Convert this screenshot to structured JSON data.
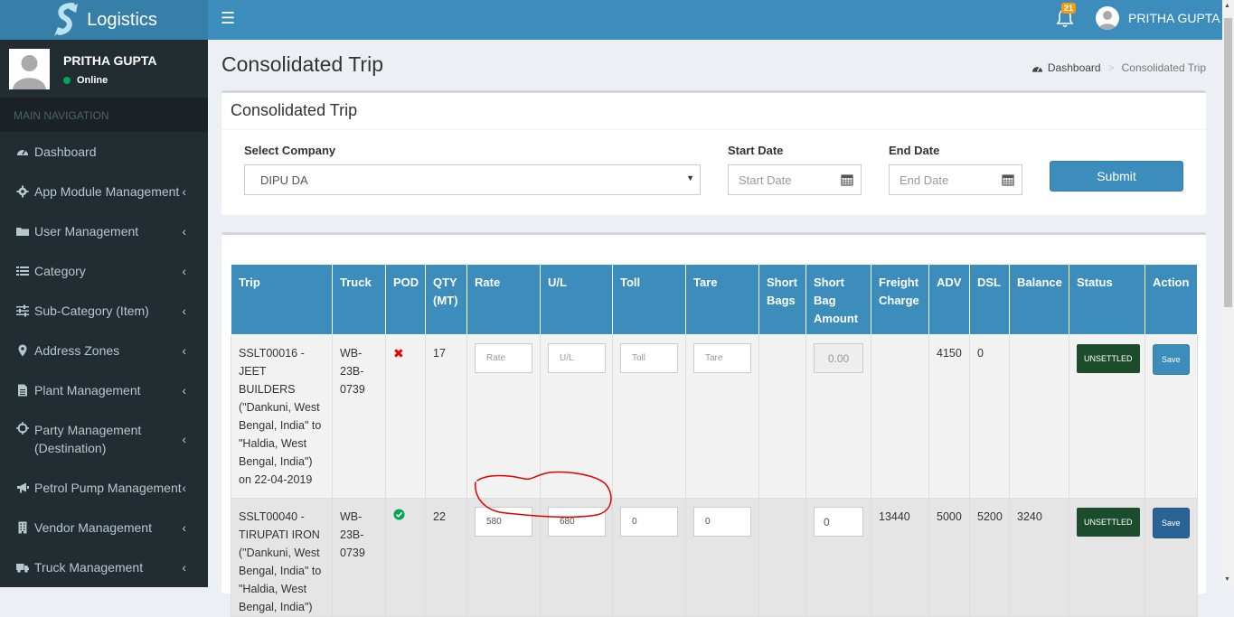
{
  "brand": {
    "name": "Logistics"
  },
  "header": {
    "notification_count": "21",
    "user_name": "PRITHA GUPTA"
  },
  "sidebar": {
    "user": {
      "name": "PRITHA GUPTA",
      "status": "Online"
    },
    "nav_header": "MAIN NAVIGATION",
    "items": [
      {
        "label": "Dashboard",
        "icon": "dashboard-icon"
      },
      {
        "label": "App Module Management",
        "icon": "gear-icon"
      },
      {
        "label": "User Management",
        "icon": "folder-icon"
      },
      {
        "label": "Category",
        "icon": "list-icon"
      },
      {
        "label": "Sub-Category (Item)",
        "icon": "sliders-icon"
      },
      {
        "label": "Address Zones",
        "icon": "map-marker-icon"
      },
      {
        "label": "Plant Management",
        "icon": "file-icon"
      },
      {
        "label": "Party Management (Destination)",
        "icon": "crosshair-icon"
      },
      {
        "label": "Petrol Pump Management",
        "icon": "bullhorn-icon"
      },
      {
        "label": "Vendor Management",
        "icon": "building-icon"
      },
      {
        "label": "Truck Management",
        "icon": "truck-icon"
      }
    ]
  },
  "page": {
    "title": "Consolidated Trip",
    "breadcrumb": {
      "home": "Dashboard",
      "current": "Consolidated Trip"
    }
  },
  "filter": {
    "box_title": "Consolidated Trip",
    "company_label": "Select Company",
    "company_value": "DIPU DA",
    "start_label": "Start Date",
    "start_placeholder": "Start Date",
    "end_label": "End Date",
    "end_placeholder": "End Date",
    "submit_label": "Submit"
  },
  "table": {
    "headers": [
      "Trip",
      "Truck",
      "POD",
      "QTY (MT)",
      "Rate",
      "U/L",
      "Toll",
      "Tare",
      "Short Bags",
      "Short Bag Amount",
      "Freight Charge",
      "ADV",
      "DSL",
      "Balance",
      "Status",
      "Action"
    ],
    "rows": [
      {
        "trip": "SSLT00016 - JEET BUILDERS (\"Dankuni, West Bengal, India\" to \"Haldia, West Bengal, India\") on 22-04-2019",
        "truck": "WB-23B-0739",
        "pod": "no",
        "qty": "17",
        "rate_placeholder": "Rate",
        "ul_placeholder": "U/L",
        "toll_placeholder": "Toll",
        "tare_placeholder": "Tare",
        "short_bags": "",
        "short_bag_amount": "0.00",
        "freight_charge": "",
        "adv": "4150",
        "dsl": "0",
        "balance": "",
        "status": "UNSETTLED",
        "action": "Save"
      },
      {
        "trip": "SSLT00040 - TIRUPATI IRON (\"Dankuni, West Bengal, India\" to \"Haldia, West Bengal, India\")",
        "truck": "WB-23B-0739",
        "pod": "yes",
        "qty": "22",
        "rate": "580",
        "ul": "680",
        "toll": "0",
        "tare": "0",
        "short_bags": "",
        "short_bag_amount": "0",
        "freight_charge": "13440",
        "adv": "5000",
        "dsl": "5200",
        "balance": "3240",
        "status": "UNSETTLED",
        "action": "Save"
      }
    ]
  },
  "colors": {
    "header": "#3c8dbc",
    "logo_bg": "#367fa9",
    "sidebar": "#222d32",
    "status_badge": "#1b4d2c",
    "annotation": "#e00000"
  }
}
